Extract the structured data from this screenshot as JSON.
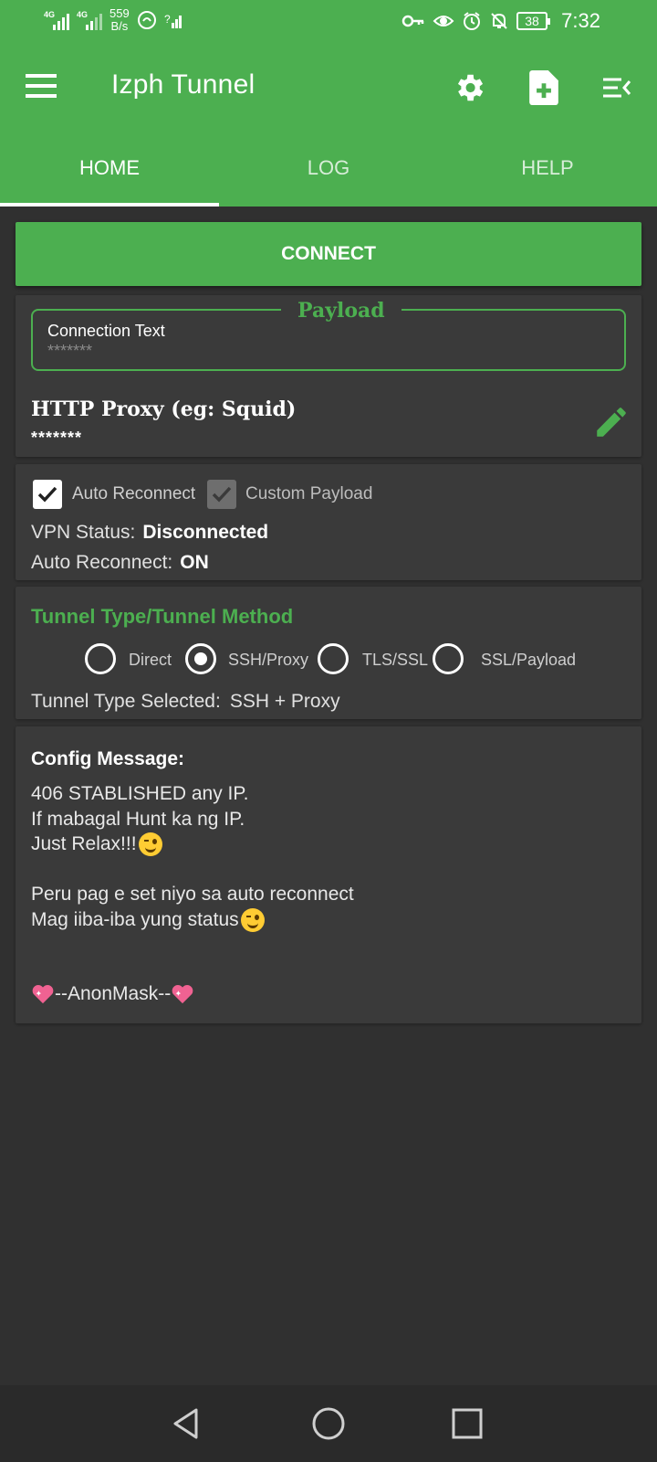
{
  "status_bar": {
    "network1": "4G",
    "network2": "4G",
    "net_speed_value": "559",
    "net_speed_unit": "B/s",
    "battery": "38",
    "time": "7:32",
    "icons": [
      "signal-icon",
      "data-saver-icon",
      "wifi-icon",
      "vpn-key-icon",
      "eye-icon",
      "alarm-icon",
      "notifications-off-icon",
      "battery-icon"
    ]
  },
  "toolbar": {
    "title": "Izph Tunnel",
    "icons": [
      "menu-icon",
      "settings-icon",
      "add-file-icon",
      "menu-collapse-icon"
    ]
  },
  "tabs": [
    {
      "label": "HOME",
      "active": true
    },
    {
      "label": "LOG",
      "active": false
    },
    {
      "label": "HELP",
      "active": false
    }
  ],
  "connect_label": "CONNECT",
  "payload": {
    "legend": "Payload",
    "label": "Connection Text",
    "value": "*******"
  },
  "proxy": {
    "label": "HTTP Proxy (eg: Squid)",
    "value": "*******"
  },
  "options": {
    "auto_reconnect_label": "Auto Reconnect",
    "custom_payload_label": "Custom Payload"
  },
  "status": {
    "vpn_label": "VPN Status:",
    "vpn_value": "Disconnected",
    "auto_label": "Auto Reconnect:",
    "auto_value": "ON"
  },
  "tunnel": {
    "title": "Tunnel Type/Tunnel Method",
    "options": [
      {
        "label": "Direct",
        "selected": false
      },
      {
        "label": "SSH/Proxy",
        "selected": true
      },
      {
        "label": "TLS/SSL",
        "selected": false
      },
      {
        "label": "SSL/Payload",
        "selected": false
      }
    ],
    "selected_label": "Tunnel Type Selected:",
    "selected_value": "SSH + Proxy"
  },
  "config": {
    "title": "Config Message:",
    "line1": "406 STABLISHED any IP.",
    "line2": "If mabagal Hunt ka ng IP.",
    "line3": "Just Relax!!!",
    "line4": "Peru pag e set niyo sa auto reconnect",
    "line5": "Mag iiba-iba yung status",
    "signature": "--AnonMask--"
  },
  "colors": {
    "accent": "#4caf50",
    "background": "#303030",
    "card": "#3a3a3a"
  }
}
